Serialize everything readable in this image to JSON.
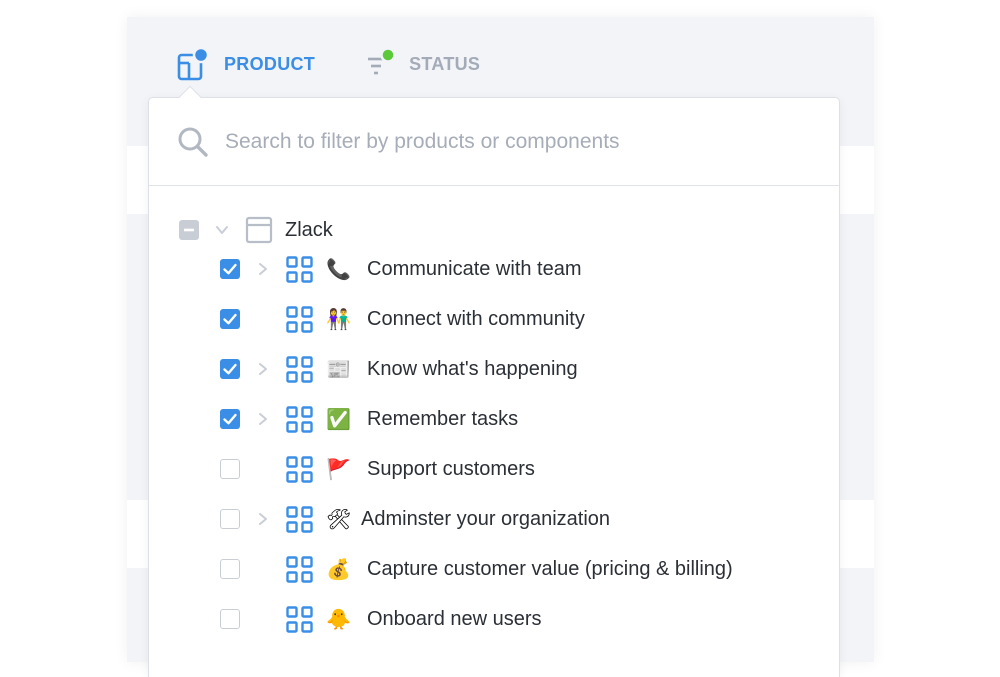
{
  "tabs": [
    {
      "label": "PRODUCT",
      "icon": "product-icon",
      "active": true,
      "dot_color": "#3a8ee6"
    },
    {
      "label": "STATUS",
      "icon": "status-filter-icon",
      "active": false,
      "dot_color": "#5cc93a"
    }
  ],
  "search": {
    "placeholder": "Search to filter by products or components",
    "value": ""
  },
  "tree": {
    "root": {
      "label": "Zlack",
      "state": "partial",
      "expanded": true,
      "icon": "product-window-icon"
    },
    "items": [
      {
        "label": "Communicate with team",
        "checked": true,
        "has_children": true,
        "emoji": "📞",
        "icon": "telephone-icon"
      },
      {
        "label": "Connect with community",
        "checked": true,
        "has_children": false,
        "emoji": "👫",
        "icon": "people-icon"
      },
      {
        "label": "Know what's happening",
        "checked": true,
        "has_children": true,
        "emoji": "📰",
        "icon": "newspaper-icon"
      },
      {
        "label": "Remember tasks",
        "checked": true,
        "has_children": true,
        "emoji": "✅",
        "icon": "check-mark-icon"
      },
      {
        "label": "Support customers",
        "checked": false,
        "has_children": false,
        "emoji": "🚩",
        "icon": "flag-icon"
      },
      {
        "label": "Adminster your organization",
        "checked": false,
        "has_children": true,
        "emoji": "🛠",
        "icon": "tools-icon"
      },
      {
        "label": "Capture customer value (pricing & billing)",
        "checked": false,
        "has_children": false,
        "emoji": "💰",
        "icon": "money-bag-icon"
      },
      {
        "label": "Onboard new users",
        "checked": false,
        "has_children": false,
        "emoji": "🐥",
        "icon": "chick-icon"
      }
    ]
  },
  "colors": {
    "accent": "#3a8ee6",
    "muted": "#a3abb8",
    "checkbox_border": "#c9ced6",
    "status_dot": "#5cc93a"
  }
}
